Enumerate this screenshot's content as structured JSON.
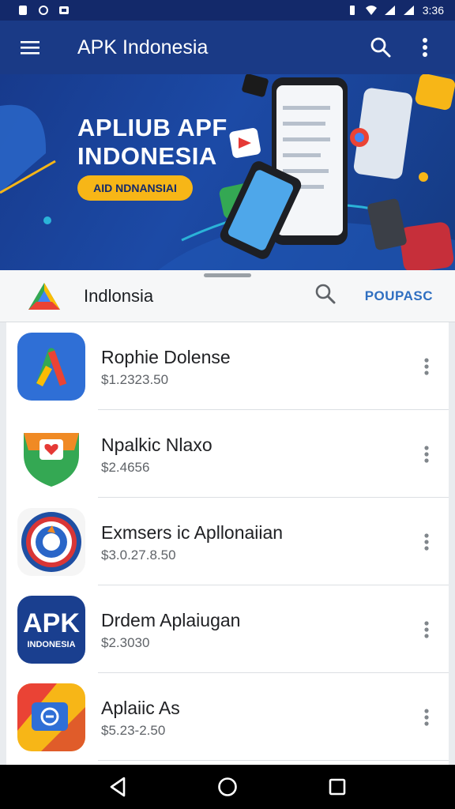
{
  "status_bar": {
    "time": "3:36"
  },
  "app_bar": {
    "title": "APK Indonesia"
  },
  "banner": {
    "headline_line1": "APLIUB APF",
    "headline_line2": "INDONESIA",
    "pill_label": "AID NDNANSIAI"
  },
  "search_strip": {
    "label": "Indlonsia",
    "action_label": "POUPASC"
  },
  "apps": [
    {
      "name": "Rophie Dolense",
      "price": "$1.2323.50",
      "icon": "drive-style-icon"
    },
    {
      "name": "Npalkic Nlaxo",
      "price": "$2.4656",
      "icon": "heart-shield-icon"
    },
    {
      "name": "Exmsers ic Apllonaiian",
      "price": "$3.0.27.8.50",
      "icon": "target-ring-icon"
    },
    {
      "name": "Drdem Aplaiugan",
      "price": "$2.3030",
      "icon": "apk-indonesia-icon"
    },
    {
      "name": "Aplaiic As",
      "price": "$5.23-2.50",
      "icon": "screen-cast-icon"
    }
  ],
  "apk_icon_text": {
    "big": "APK",
    "small": "INDONESIA"
  },
  "colors": {
    "app_bar": "#1a3a86",
    "status_bar": "#13296a",
    "accent_yellow": "#f7b617",
    "action_blue": "#2f6fc1"
  }
}
